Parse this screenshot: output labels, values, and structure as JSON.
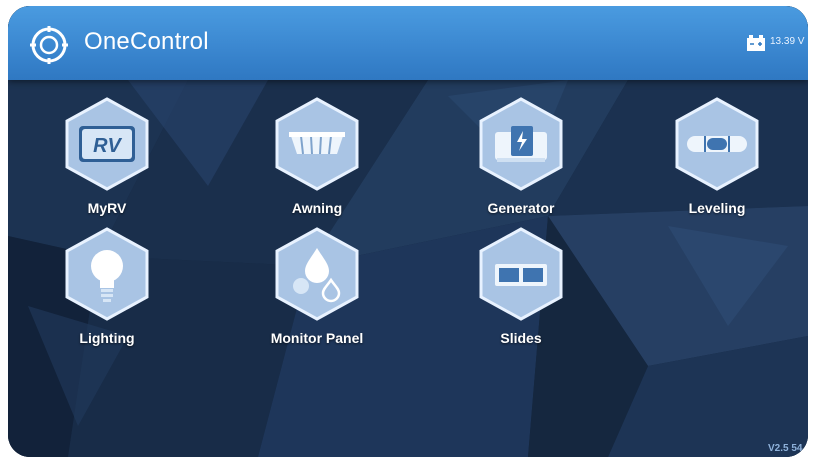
{
  "header": {
    "title": "OneControl",
    "voltage": "13.39 V"
  },
  "tiles": [
    {
      "label": "MyRV",
      "icon": "rv-logo-icon"
    },
    {
      "label": "Awning",
      "icon": "awning-icon"
    },
    {
      "label": "Generator",
      "icon": "generator-icon"
    },
    {
      "label": "Leveling",
      "icon": "leveling-icon"
    },
    {
      "label": "Lighting",
      "icon": "lightbulb-icon"
    },
    {
      "label": "Monitor Panel",
      "icon": "tank-monitor-icon"
    },
    {
      "label": "Slides",
      "icon": "slides-icon"
    }
  ],
  "footer": {
    "version": "V2.5 54"
  },
  "colors": {
    "header": "#3a86cf",
    "background": "#14253d",
    "hex_fill": "#a9c4e4",
    "hex_border": "#e8f2ff"
  }
}
